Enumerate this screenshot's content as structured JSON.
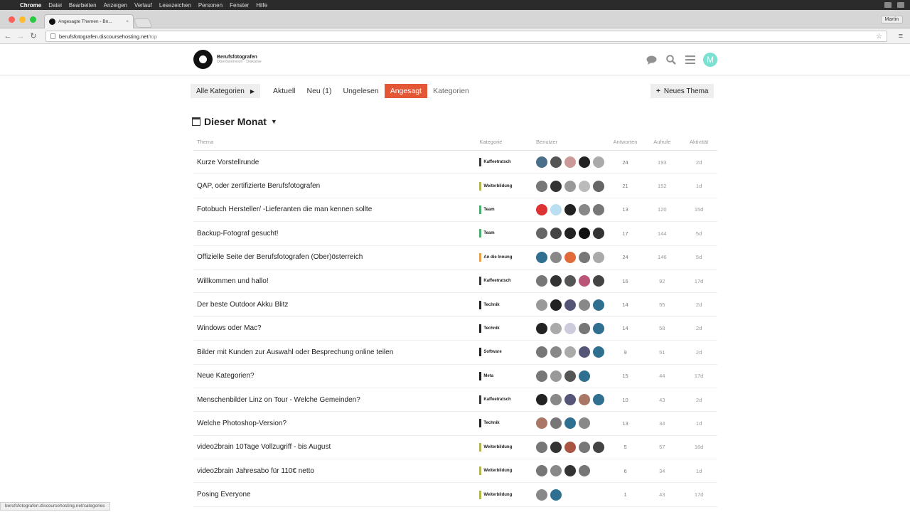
{
  "os_menubar": {
    "app": "Chrome",
    "items": [
      "Datei",
      "Bearbeiten",
      "Anzeigen",
      "Verlauf",
      "Lesezeichen",
      "Personen",
      "Fenster",
      "Hilfe"
    ]
  },
  "browser": {
    "tab_title": "Angesagte Themen - Bn...",
    "profile": "Martin",
    "url_host": "berufsfotografen.discoursehosting.net",
    "url_path": "/top",
    "status_url": "berufsfotografen.discoursehosting.net/categories"
  },
  "site": {
    "name": "Berufsfotografen",
    "tagline": "Oberösterreich · Diskurse"
  },
  "nav": {
    "category_dropdown": "Alle Kategorien",
    "pills": [
      "Aktuell",
      "Neu (1)",
      "Ungelesen",
      "Angesagt",
      "Kategorien"
    ],
    "active": "Angesagt",
    "new_topic": "Neues Thema"
  },
  "period": "Dieser Monat",
  "columns": {
    "topic": "Thema",
    "category": "Kategorie",
    "users": "Benutzer",
    "replies": "Antworten",
    "views": "Aufrufe",
    "activity": "Aktivität"
  },
  "categories": {
    "Kaffeetratsch": "#3a3a3a",
    "Weiterbildung": "#b3b550",
    "Team": "#4cae6e",
    "An die Innung": "#e8a14a",
    "Technik": "#222222",
    "Software": "#222222",
    "Meta": "#222222"
  },
  "topics": [
    {
      "title": "Kurze Vorstellrunde",
      "category": "Kaffeetratsch",
      "replies": "24",
      "views": "193",
      "activity": "2d",
      "users": [
        "#4a6f8a",
        "#555",
        "#c99",
        "#222",
        "#aaa"
      ]
    },
    {
      "title": "QAP, oder zertifizierte Berufsfotografen",
      "category": "Weiterbildung",
      "replies": "21",
      "views": "152",
      "activity": "1d",
      "users": [
        "#777",
        "#333",
        "#999",
        "#bbb",
        "#666"
      ]
    },
    {
      "title": "Fotobuch Hersteller/ -Lieferanten die man kennen sollte",
      "category": "Team",
      "replies": "13",
      "views": "120",
      "activity": "15d",
      "users": [
        "#d33",
        "#b9dff0",
        "#222",
        "#888",
        "#777"
      ]
    },
    {
      "title": "Backup-Fotograf gesucht!",
      "category": "Team",
      "replies": "17",
      "views": "144",
      "activity": "5d",
      "users": [
        "#666",
        "#444",
        "#222",
        "#111",
        "#333"
      ]
    },
    {
      "title": "Offizielle Seite der Berufsfotografen (Ober)österreich",
      "category": "An die Innung",
      "replies": "24",
      "views": "146",
      "activity": "5d",
      "users": [
        "#2f6f8f",
        "#888",
        "#e06a3a",
        "#777",
        "#aaa"
      ]
    },
    {
      "title": "Willkommen und hallo!",
      "category": "Kaffeetratsch",
      "replies": "16",
      "views": "92",
      "activity": "17d",
      "users": [
        "#777",
        "#333",
        "#555",
        "#b57",
        "#444"
      ]
    },
    {
      "title": "Der beste Outdoor Akku Blitz",
      "category": "Technik",
      "replies": "14",
      "views": "55",
      "activity": "2d",
      "users": [
        "#999",
        "#222",
        "#557",
        "#888",
        "#2f6f8f"
      ]
    },
    {
      "title": "Windows oder Mac?",
      "category": "Technik",
      "replies": "14",
      "views": "58",
      "activity": "2d",
      "users": [
        "#222",
        "#aaa",
        "#ccd",
        "#777",
        "#2f6f8f"
      ]
    },
    {
      "title": "Bilder mit Kunden zur Auswahl oder Besprechung online teilen",
      "category": "Software",
      "replies": "9",
      "views": "51",
      "activity": "2d",
      "users": [
        "#777",
        "#888",
        "#aaa",
        "#557",
        "#2f6f8f"
      ]
    },
    {
      "title": "Neue Kategorien?",
      "category": "Meta",
      "replies": "15",
      "views": "44",
      "activity": "17d",
      "users": [
        "#777",
        "#999",
        "#555",
        "#2f6f8f"
      ]
    },
    {
      "title": "Menschenbilder Linz on Tour - Welche Gemeinden?",
      "category": "Kaffeetratsch",
      "replies": "10",
      "views": "43",
      "activity": "2d",
      "users": [
        "#222",
        "#888",
        "#557",
        "#a76",
        "#2f6f8f"
      ]
    },
    {
      "title": "Welche Photoshop-Version?",
      "category": "Technik",
      "replies": "13",
      "views": "34",
      "activity": "1d",
      "users": [
        "#a76",
        "#777",
        "#2f6f8f",
        "#888"
      ]
    },
    {
      "title": "video2brain 10Tage Vollzugriff - bis August",
      "category": "Weiterbildung",
      "replies": "5",
      "views": "57",
      "activity": "16d",
      "users": [
        "#777",
        "#333",
        "#a54",
        "#777",
        "#444"
      ]
    },
    {
      "title": "video2brain Jahresabo für 110€ netto",
      "category": "Weiterbildung",
      "replies": "6",
      "views": "34",
      "activity": "1d",
      "users": [
        "#777",
        "#888",
        "#333",
        "#777"
      ]
    },
    {
      "title": "Posing Everyone",
      "category": "Weiterbildung",
      "replies": "1",
      "views": "43",
      "activity": "17d",
      "users": [
        "#888",
        "#2f6f8f"
      ]
    }
  ]
}
